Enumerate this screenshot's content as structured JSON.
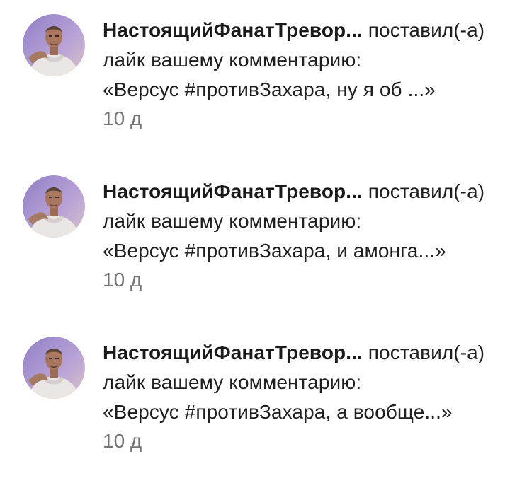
{
  "notifications": [
    {
      "author": "НастоящийФанатТревор...",
      "action": " поставил(-а) лайк вашему комментарию:",
      "comment": "«Версус #противЗахара, ну я об ...»",
      "time": "10 д",
      "avatar_icon": "trevor-avatar-icon"
    },
    {
      "author": "НастоящийФанатТревор...",
      "action": " поставил(-а) лайк вашему комментарию:",
      "comment": "«Версус #противЗахара, и амонга...»",
      "time": "10 д",
      "avatar_icon": "trevor-avatar-icon"
    },
    {
      "author": "НастоящийФанатТревор...",
      "action": " поставил(-а) лайк вашему комментарию:",
      "comment": "«Версус #противЗахара, а вообще...»",
      "time": "10 д",
      "avatar_icon": "trevor-avatar-icon"
    }
  ],
  "colors": {
    "time_text": "#767676",
    "avatar_bg": "#b9a3d6"
  }
}
